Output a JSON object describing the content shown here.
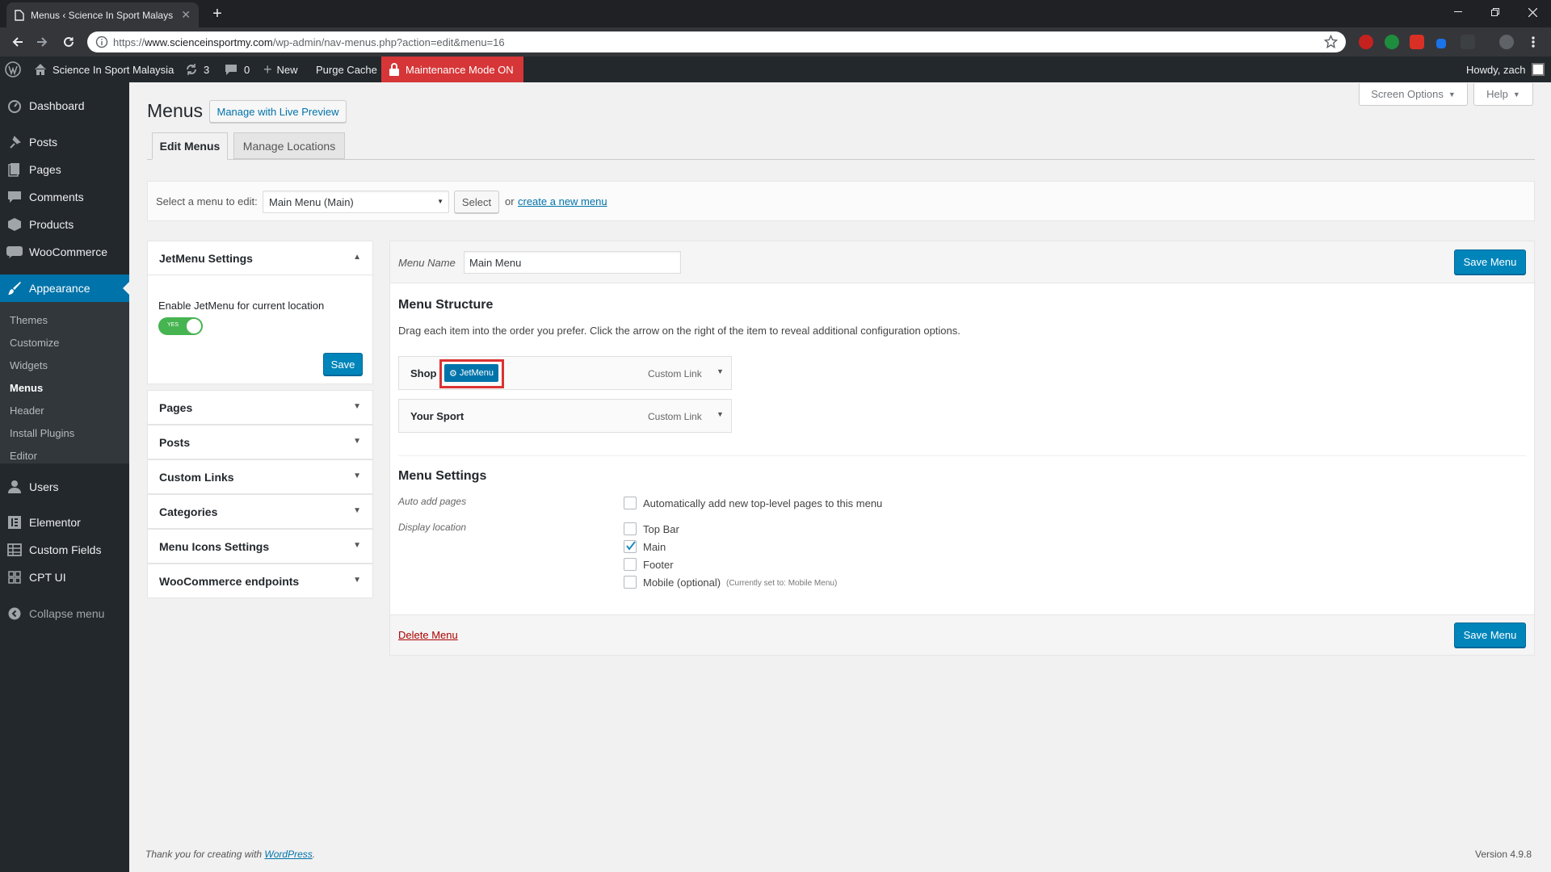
{
  "browser": {
    "tab_title": "Menus ‹ Science In Sport Malays",
    "url_prefix": "https://",
    "url_host": "www.scienceinsportmy.com",
    "url_path": "/wp-admin/nav-menus.php?action=edit&menu=16"
  },
  "adminbar": {
    "site_name": "Science In Sport Malaysia",
    "updates_count": "3",
    "comments_count": "0",
    "new_label": "New",
    "purge_label": "Purge Cache",
    "maintenance_label": "Maintenance Mode ON",
    "howdy": "Howdy, zach"
  },
  "sidebar": {
    "items": [
      {
        "label": "Dashboard",
        "icon": "dashboard-icon"
      },
      {
        "label": "Posts",
        "icon": "pin-icon"
      },
      {
        "label": "Pages",
        "icon": "pages-icon"
      },
      {
        "label": "Comments",
        "icon": "comment-icon"
      },
      {
        "label": "Products",
        "icon": "box-icon"
      },
      {
        "label": "WooCommerce",
        "icon": "woo-icon"
      },
      {
        "label": "Appearance",
        "icon": "brush-icon"
      },
      {
        "label": "Users",
        "icon": "user-icon"
      },
      {
        "label": "Elementor",
        "icon": "elementor-icon"
      },
      {
        "label": "Custom Fields",
        "icon": "fields-icon"
      },
      {
        "label": "CPT UI",
        "icon": "grid-icon"
      },
      {
        "label": "Collapse menu",
        "icon": "collapse-icon"
      }
    ],
    "appearance_sub": [
      "Themes",
      "Customize",
      "Widgets",
      "Menus",
      "Header",
      "Install Plugins",
      "Editor"
    ]
  },
  "header": {
    "title": "Menus",
    "live_preview": "Manage with Live Preview",
    "screen_options": "Screen Options",
    "help": "Help",
    "tabs": [
      "Edit Menus",
      "Manage Locations"
    ]
  },
  "selectbar": {
    "label": "Select a menu to edit:",
    "selected": "Main Menu (Main)",
    "select_btn": "Select",
    "or": "or",
    "create_link": "create a new menu",
    "period": "."
  },
  "jetmenu": {
    "title": "JetMenu Settings",
    "enable_label": "Enable JetMenu for current location",
    "toggle_text": "YES",
    "save": "Save"
  },
  "accordions": [
    "Pages",
    "Posts",
    "Custom Links",
    "Categories",
    "Menu Icons Settings",
    "WooCommerce endpoints"
  ],
  "menu": {
    "name_label": "Menu Name",
    "name_value": "Main Menu",
    "save_menu": "Save Menu",
    "structure_title": "Menu Structure",
    "structure_desc": "Drag each item into the order you prefer. Click the arrow on the right of the item to reveal additional configuration options.",
    "items": [
      {
        "title": "Shop",
        "badge": "JetMenu",
        "type": "Custom Link"
      },
      {
        "title": "Your Sport",
        "badge": "",
        "type": "Custom Link"
      }
    ],
    "settings_title": "Menu Settings",
    "auto_add_label": "Auto add pages",
    "auto_add_text": "Automatically add new top-level pages to this menu",
    "display_label": "Display location",
    "locations": [
      {
        "label": "Top Bar",
        "checked": false,
        "note": ""
      },
      {
        "label": "Main",
        "checked": true,
        "note": ""
      },
      {
        "label": "Footer",
        "checked": false,
        "note": ""
      },
      {
        "label": "Mobile (optional)",
        "checked": false,
        "note": "(Currently set to: Mobile Menu)"
      }
    ],
    "delete_link": "Delete Menu"
  },
  "footer": {
    "thanks": "Thank you for creating with",
    "wp_link": "WordPress",
    "period": ".",
    "version": "Version 4.9.8"
  },
  "colors": {
    "wp_blue": "#0085ba",
    "admin_dark": "#23282d",
    "maintenance_red": "#d63638",
    "highlight_red": "#dc3232",
    "toggle_green": "#46b450"
  }
}
